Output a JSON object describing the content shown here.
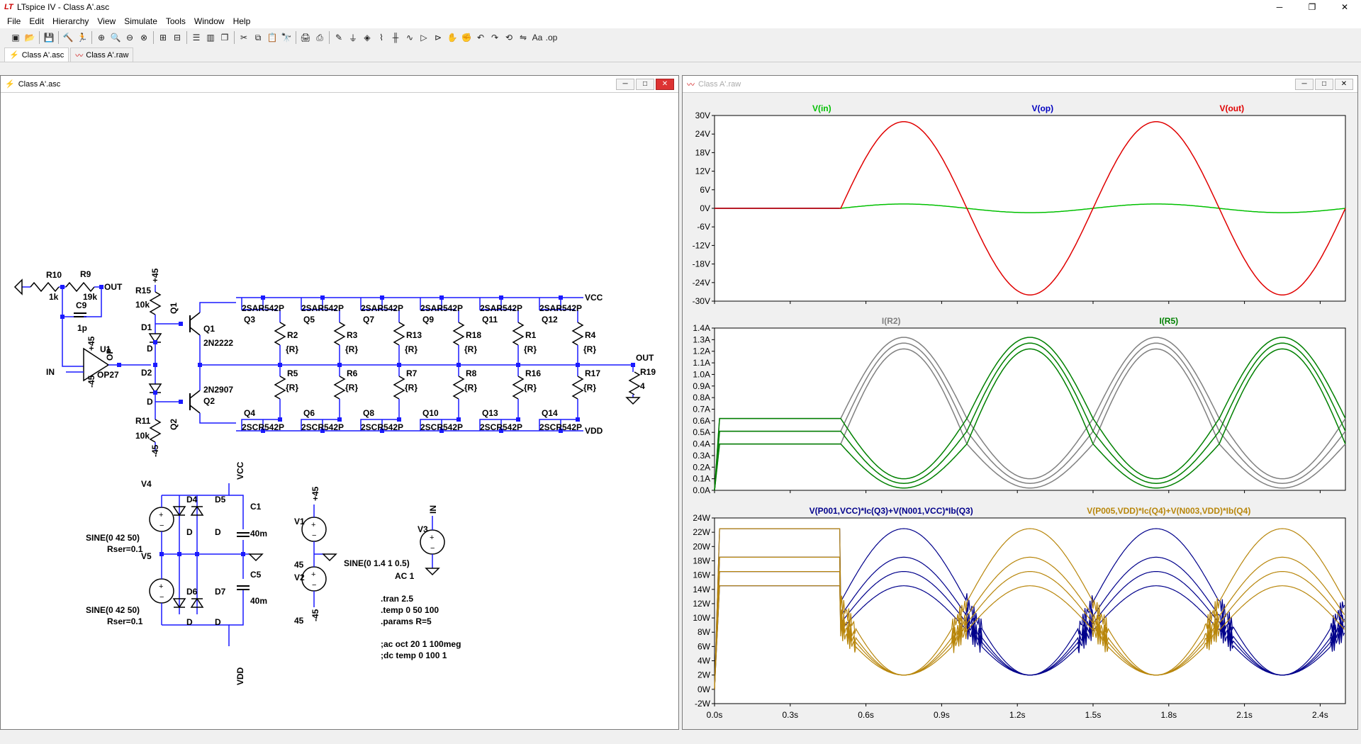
{
  "app": {
    "title": "LTspice IV - Class A'.asc"
  },
  "window_controls": {
    "minimize": "─",
    "maximize": "❐",
    "close": "✕"
  },
  "menu": [
    "File",
    "Edit",
    "Hierarchy",
    "View",
    "Simulate",
    "Tools",
    "Window",
    "Help"
  ],
  "tabs": [
    {
      "label": "Class A'.asc",
      "icon": "schematic-icon"
    },
    {
      "label": "Class A'.raw",
      "icon": "waveform-icon"
    }
  ],
  "toolbar_icons": [
    "new-schematic-icon",
    "open-icon",
    "|",
    "save-icon",
    "|",
    "control-panel-icon",
    "run-icon",
    "|",
    "zoom-in-icon",
    "zoom-pan-icon",
    "zoom-out-icon",
    "zoom-fit-icon",
    "|",
    "autorange-icon",
    "autorange-x-icon",
    "|",
    "tile-horizontal-icon",
    "tile-vertical-icon",
    "cascade-icon",
    "|",
    "cut-icon",
    "copy-icon",
    "paste-icon",
    "find-icon",
    "|",
    "print-icon",
    "print-preview-icon",
    "|",
    "draw-wire-icon",
    "ground-icon",
    "label-net-icon",
    "resistor-icon",
    "capacitor-icon",
    "inductor-icon",
    "diode-icon",
    "component-icon",
    "move-icon",
    "drag-icon",
    "undo-icon",
    "redo-icon",
    "rotate-icon",
    "mirror-icon",
    "text-icon",
    "spice-directive-icon"
  ],
  "schematic_window": {
    "title": "Class A'.asc"
  },
  "plot_window": {
    "title": "Class A'.raw"
  },
  "schematic": {
    "components": {
      "R10": "R10",
      "R10_val": "1k",
      "R9": "R9",
      "R9_val": "19k",
      "C9": "C9",
      "C9_val": "1p",
      "OUT1": "OUT",
      "U1": "U1",
      "U1_val": "OP27",
      "IN1": "IN",
      "OP": "OP",
      "p45a": "+45",
      "m45a": "-45",
      "R15": "R15",
      "R15_val": "10k",
      "p45b": "+45",
      "D1": "D1",
      "D1_val": "D",
      "D2": "D2",
      "D2_val": "D",
      "R11": "R11",
      "R11_val": "10k",
      "m45b": "-45",
      "Q1": "Q1",
      "Q1b": "Q1",
      "Q1_val": "2N2222",
      "Q2": "Q2",
      "Q2b": "Q2",
      "Q2_val": "2N2907",
      "VCC": "VCC",
      "VDD": "VDD",
      "OUT2": "OUT",
      "R19": "R19",
      "R19_val": "4",
      "V4": "V4",
      "V4_val": "SINE(0 42 50)",
      "V4_rser": "Rser=0.1",
      "V5": "V5",
      "V5_val": "SINE(0 42 50)",
      "V5_rser": "Rser=0.1",
      "D4": "D4",
      "D5": "D5",
      "D6": "D6",
      "D7": "D7",
      "Dv": "D",
      "C1": "C1",
      "C1_val": "40m",
      "C5": "C5",
      "C5_val": "40m",
      "VCC2": "VCC",
      "VDD2": "VDD",
      "V1": "V1",
      "V1_val": "45",
      "V2": "V2",
      "V2_val": "45",
      "p45c": "+45",
      "m45c": "-45",
      "V3": "V3",
      "V3_val": "SINE(0 1.4 1 0.5)",
      "V3_ac": "AC 1",
      "IN2": "IN"
    },
    "top_transistors": [
      {
        "q": "Q3",
        "model": "2SAR542P",
        "r": "R2"
      },
      {
        "q": "Q5",
        "model": "2SAR542P",
        "r": "R3"
      },
      {
        "q": "Q7",
        "model": "2SAR542P",
        "r": "R13"
      },
      {
        "q": "Q9",
        "model": "2SAR542P",
        "r": "R18"
      },
      {
        "q": "Q11",
        "model": "2SAR542P",
        "r": "R1"
      },
      {
        "q": "Q12",
        "model": "2SAR542P",
        "r": "R4"
      }
    ],
    "bottom_transistors": [
      {
        "q": "Q4",
        "model": "2SCR542P",
        "r": "R5"
      },
      {
        "q": "Q6",
        "model": "2SCR542P",
        "r": "R6"
      },
      {
        "q": "Q8",
        "model": "2SCR542P",
        "r": "R7"
      },
      {
        "q": "Q10",
        "model": "2SCR542P",
        "r": "R8"
      },
      {
        "q": "Q13",
        "model": "2SCR542P",
        "r": "R16"
      },
      {
        "q": "Q14",
        "model": "2SCR542P",
        "r": "R17"
      }
    ],
    "resistor_value": "{R}",
    "directives": [
      ".tran 2.5",
      ".temp 0 50 100",
      ".params R=5",
      "",
      ";ac oct 20 1 100meg",
      ";dc temp 0 100 1"
    ]
  },
  "chart_data": [
    {
      "type": "line",
      "series": [
        {
          "name": "V(in)",
          "color": "#00c000",
          "x": [
            0,
            0.5,
            0.75,
            1.0,
            1.25,
            1.5,
            1.75,
            2.0,
            2.25,
            2.5
          ],
          "values": [
            0,
            0,
            1.4,
            0,
            -1.4,
            0,
            1.4,
            0,
            -1.4,
            0
          ]
        },
        {
          "name": "V(op)",
          "color": "#0000c0",
          "x": [
            0,
            0.5
          ],
          "values": [
            0,
            0
          ]
        },
        {
          "name": "V(out)",
          "color": "#e00000",
          "x": [
            0,
            0.5,
            0.75,
            1.0,
            1.25,
            1.5,
            1.75,
            2.0,
            2.25,
            2.5
          ],
          "values": [
            0,
            0,
            28,
            0,
            -28,
            0,
            28,
            0,
            -28,
            0
          ]
        }
      ],
      "yticks": [
        "30V",
        "24V",
        "18V",
        "12V",
        "6V",
        "0V",
        "-6V",
        "-12V",
        "-18V",
        "-24V",
        "-30V"
      ],
      "ylim": [
        -30,
        30
      ]
    },
    {
      "type": "line",
      "series": [
        {
          "name": "I(R2)",
          "color": "#808080",
          "peaks": [
            1.22,
            1.27,
            1.32
          ],
          "troughs": [
            0.02,
            0.06,
            0.1
          ],
          "dc": [
            0.4,
            0.51,
            0.62
          ],
          "phase": 1
        },
        {
          "name": "I(R5)",
          "color": "#008000",
          "peaks": [
            1.22,
            1.27,
            1.32
          ],
          "troughs": [
            0.02,
            0.06,
            0.1
          ],
          "dc": [
            0.4,
            0.51,
            0.62
          ],
          "phase": -1
        }
      ],
      "yticks": [
        "1.4A",
        "1.3A",
        "1.2A",
        "1.1A",
        "1.0A",
        "0.9A",
        "0.8A",
        "0.7A",
        "0.6A",
        "0.5A",
        "0.4A",
        "0.3A",
        "0.2A",
        "0.1A",
        "0.0A"
      ],
      "ylim": [
        0,
        1.4
      ]
    },
    {
      "type": "line",
      "series": [
        {
          "name": "V(P001,VCC)*Ic(Q3)+V(N001,VCC)*Ib(Q3)",
          "color": "#00008b",
          "dc": [
            14.5,
            16.5,
            18.5,
            22.5
          ],
          "phase": 1
        },
        {
          "name": "V(P005,VDD)*Ic(Q4)+V(N003,VDD)*Ib(Q4)",
          "color": "#b8860b",
          "dc": [
            14.5,
            16.5,
            18.5,
            22.5
          ],
          "phase": -1
        }
      ],
      "yticks": [
        "24W",
        "22W",
        "20W",
        "18W",
        "16W",
        "14W",
        "12W",
        "10W",
        "8W",
        "6W",
        "4W",
        "2W",
        "0W",
        "-2W"
      ],
      "ylim": [
        -2,
        24
      ]
    }
  ],
  "xaxis": {
    "ticks": [
      "0.0s",
      "0.3s",
      "0.6s",
      "0.9s",
      "1.2s",
      "1.5s",
      "1.8s",
      "2.1s",
      "2.4s"
    ],
    "xlim": [
      0,
      2.5
    ]
  }
}
